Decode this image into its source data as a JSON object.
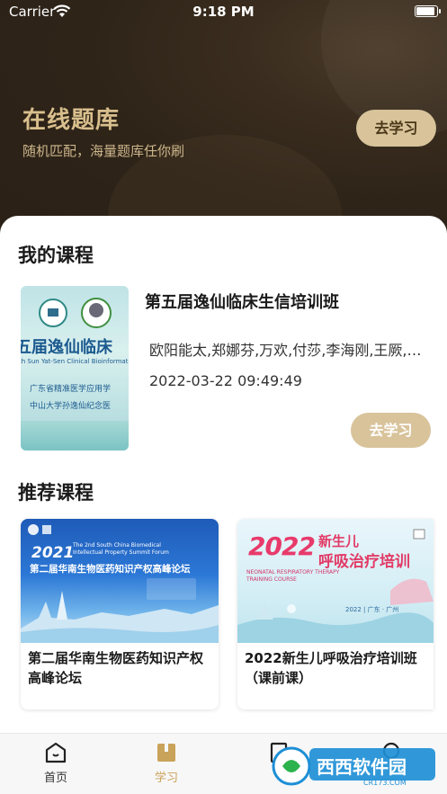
{
  "status_bar": {
    "carrier": "Carrier",
    "time": "9:18 PM",
    "battery_level": 1.0
  },
  "hero": {
    "title": "在线题库",
    "subtitle": "随机匹配，海量题库任你刷",
    "button_label": "去学习"
  },
  "my_courses": {
    "section_title": "我的课程",
    "course": {
      "name": "第五届逸仙临床生信培训班",
      "teachers": "欧阳能太,郑娜芬,万欢,付莎,李海刚,王厥,…",
      "date": "2022-03-22 09:49:49",
      "button_label": "去学习",
      "thumb": {
        "headline": "五届逸仙临床",
        "subline": "th Sun Yat-Sen Clinical Bioinformatic",
        "line1": "广东省精准医学应用学",
        "line2": "中山大学孙逸仙纪念医"
      }
    }
  },
  "recommended": {
    "section_title": "推荐课程",
    "items": [
      {
        "title": "第二届华南生物医药知识产权高峰论坛",
        "poster": {
          "year": "2021",
          "en": "The 2nd South China Biomedical Intellectual Property Summit Forum",
          "cn": "第二届华南生物医药知识产权高峰论坛"
        }
      },
      {
        "title": "2022新生儿呼吸治疗培训班（课前课）",
        "poster": {
          "year": "2022",
          "cn_top": "新生儿",
          "cn_main": "呼吸治疗培训",
          "en": "NEONATAL RESPIRATORY THERAPY TRAINING COURSE",
          "loc": "2022 | 广东 · 广州"
        }
      }
    ]
  },
  "tabbar": {
    "items": [
      {
        "label": "首页"
      },
      {
        "label": "学习"
      },
      {
        "label": ""
      },
      {
        "label": ""
      }
    ],
    "active_color": "#c9a35a"
  },
  "watermark": {
    "text": "西西软件园",
    "url_text": "CR173.COM"
  }
}
